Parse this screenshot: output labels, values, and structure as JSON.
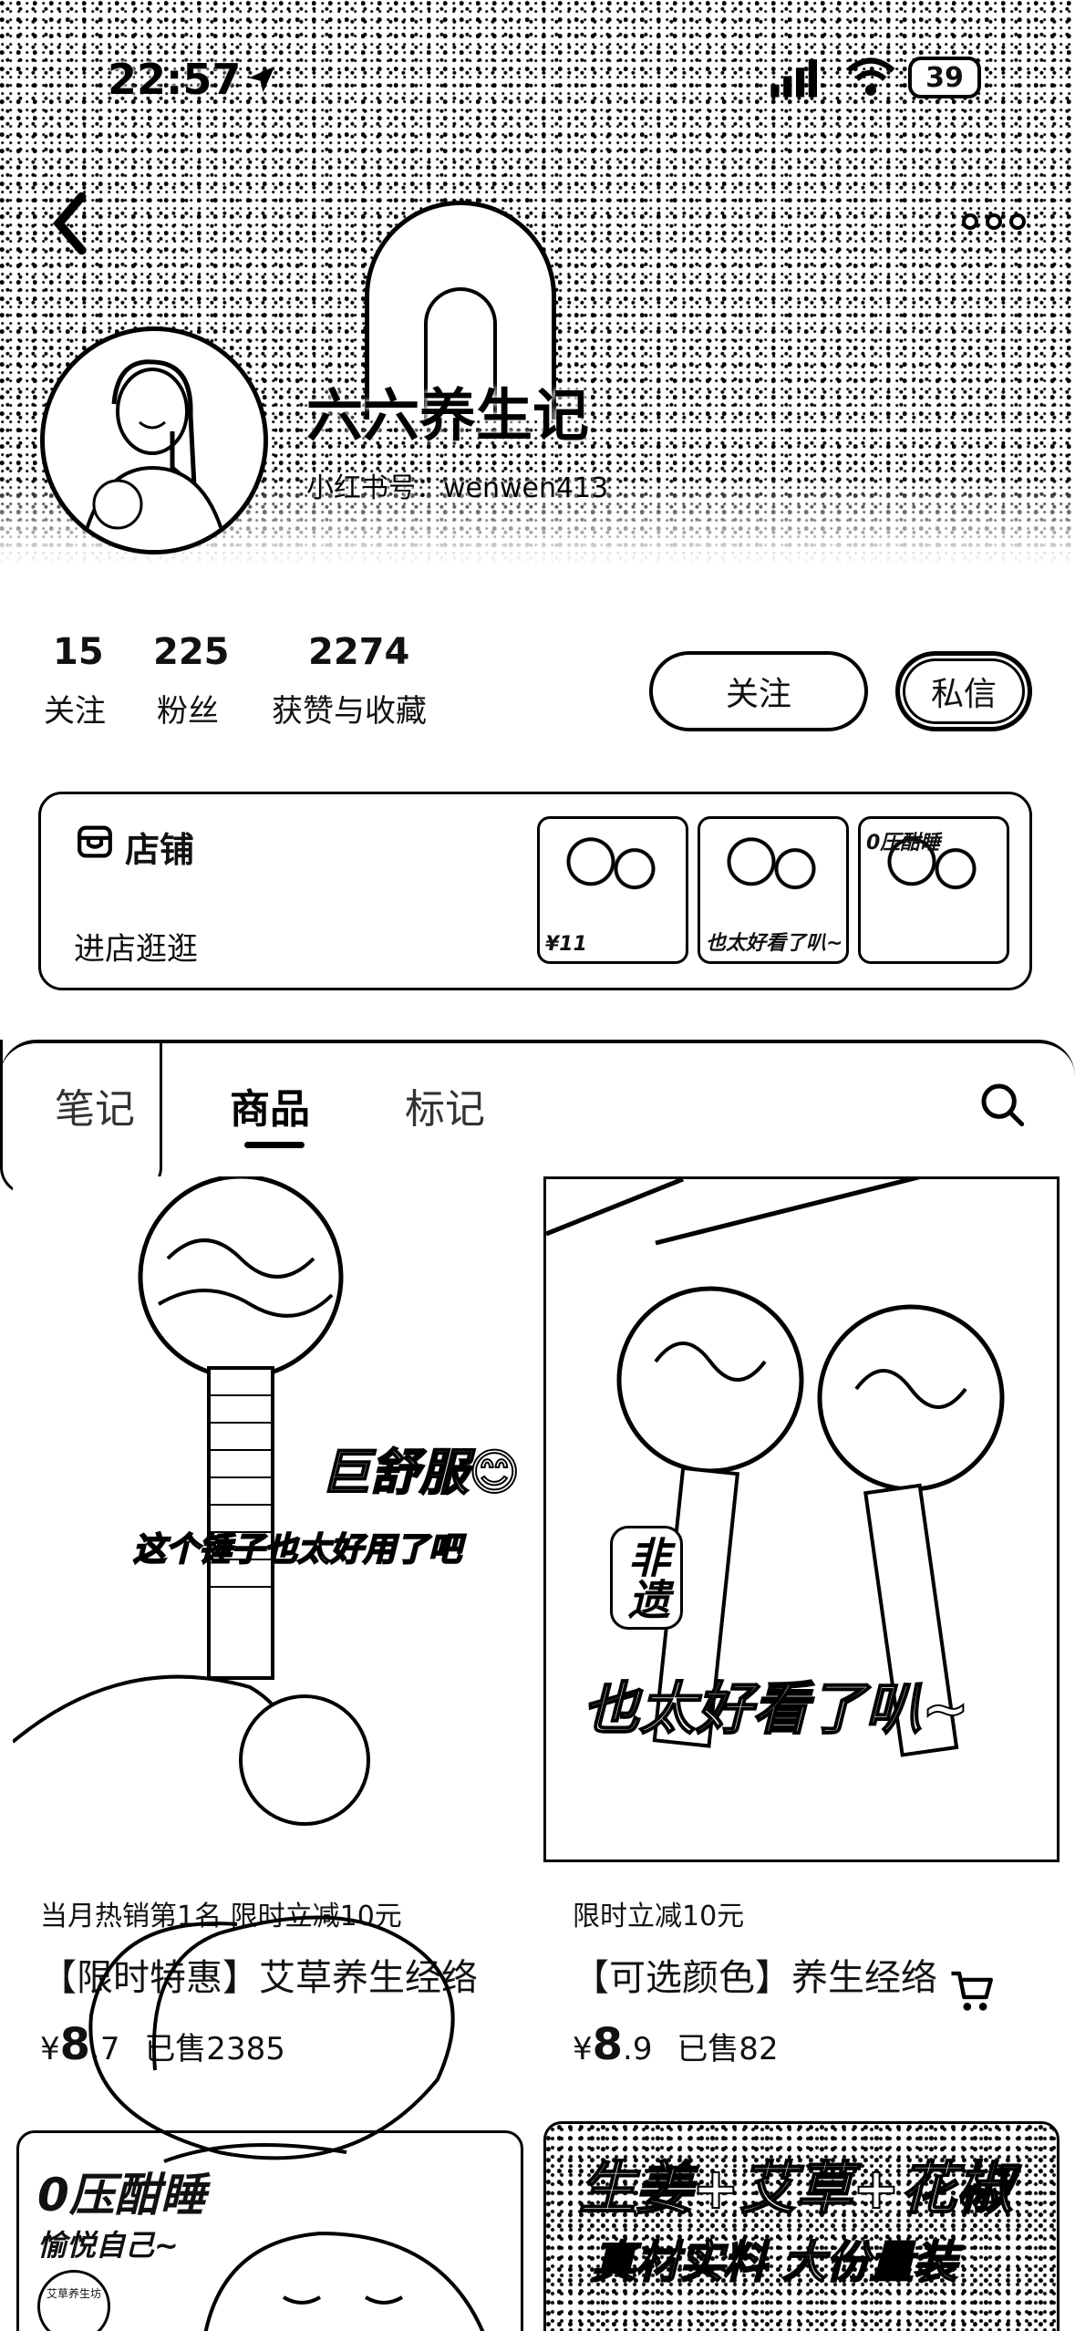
{
  "status_bar": {
    "time": "22:57",
    "battery": "39"
  },
  "profile": {
    "username": "六六养生记",
    "xhs_id": "小红书号：wenwen413",
    "stats": [
      {
        "value": "15",
        "label": "关注"
      },
      {
        "value": "225",
        "label": "粉丝"
      },
      {
        "value": "2274",
        "label": "获赞与收藏"
      }
    ],
    "follow_label": "关注",
    "message_label": "私信"
  },
  "shop": {
    "title": "店铺",
    "link": "进店逛逛",
    "thumbs": [
      "¥11",
      "也太好看了叭~",
      "0压酣睡"
    ]
  },
  "tabs": [
    {
      "label": "笔记"
    },
    {
      "label": "商品"
    },
    {
      "label": "标记"
    }
  ],
  "products": [
    {
      "overlay1": "巨舒服😊",
      "overlay2": "这个锤子也太好用了吧",
      "promo": "当月热销第1名 限时立减10元",
      "title": "【限时特惠】艾草养生经络",
      "currency": "¥",
      "price_int": "8",
      "price_dec": ".7",
      "sold": "已售2385"
    },
    {
      "overlay1": "非遗",
      "overlay2": "也太好看了叭~",
      "promo": "限时立减10元",
      "title": "【可选颜色】养生经络",
      "currency": "¥",
      "price_int": "8",
      "price_dec": ".9",
      "sold": "已售82"
    },
    {
      "overlay1": "0压酣睡",
      "overlay2": "愉悦自己~",
      "brand": "艾草养生坊"
    },
    {
      "overlay1": "生姜+艾草+花椒",
      "overlay2": "真材实料 大份量装"
    }
  ]
}
